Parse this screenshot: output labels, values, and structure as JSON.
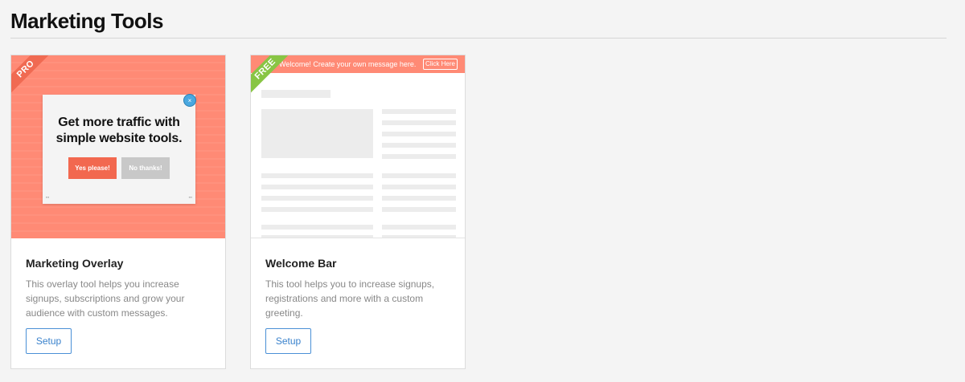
{
  "page": {
    "title": "Marketing Tools"
  },
  "colors": {
    "accent_coral": "#ff8a75",
    "pro_ribbon": "#f06a52",
    "free_ribbon": "#88c544",
    "setup_button": "#3a82cc"
  },
  "cards": [
    {
      "badge": "PRO",
      "preview": {
        "headline": "Get more traffic with simple website tools.",
        "yes_label": "Yes please!",
        "no_label": "No thanks!",
        "close_icon": "close-icon",
        "close_glyph": "×"
      },
      "title": "Marketing Overlay",
      "description": "This overlay tool helps you increase signups, subscriptions and grow your audience with custom messages.",
      "button_label": "Setup"
    },
    {
      "badge": "FREE",
      "preview": {
        "bar_text": "Welcome! Create your own message here.",
        "bar_button": "Click Here"
      },
      "title": "Welcome Bar",
      "description": "This tool helps you to increase signups, registrations and more with a custom greeting.",
      "button_label": "Setup"
    }
  ]
}
